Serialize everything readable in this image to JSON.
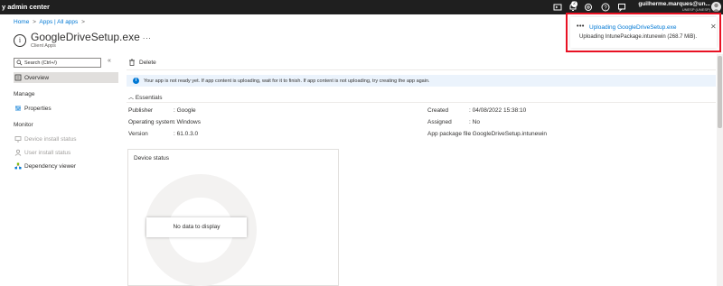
{
  "header": {
    "brand": "y admin center",
    "notification_count": "2",
    "user_name": "guilherme.marques@un...",
    "user_org": "UNESP (UNESP)"
  },
  "breadcrumb": {
    "items": [
      "Home",
      "Apps | All apps"
    ],
    "separator": ">"
  },
  "page": {
    "title": "GoogleDriveSetup.exe",
    "subtitle": "Client Apps",
    "more": "..."
  },
  "sidebar": {
    "search_placeholder": "Search (Ctrl+/)",
    "collapse": "«",
    "overview": "Overview",
    "manage_section": "Manage",
    "properties": "Properties",
    "monitor_section": "Monitor",
    "device_install_status": "Device install status",
    "user_install_status": "User install status",
    "dependency_viewer": "Dependency viewer"
  },
  "toolbar": {
    "delete_label": "Delete"
  },
  "info": {
    "message": "Your app is not ready yet. If app content is uploading, wait for it to finish. If app content is not uploading, try creating the app again."
  },
  "essentials": {
    "header": "Essentials",
    "left": [
      {
        "label": "Publisher",
        "value": "Google"
      },
      {
        "label": "Operating system",
        "value": "Windows"
      },
      {
        "label": "Version",
        "value": "61.0.3.0"
      }
    ],
    "right": [
      {
        "label": "Created",
        "value": "04/08/2022 15:38:10"
      },
      {
        "label": "Assigned",
        "value": "No"
      },
      {
        "label": "App package file",
        "value": "GoogleDriveSetup.intunewin"
      }
    ]
  },
  "device_status": {
    "title": "Device status",
    "empty": "No data to display"
  },
  "notification": {
    "title": "Uploading GoogleDriveSetup.exe",
    "message": "Uploading IntunePackage.intunewin (268.7 MiB).",
    "dots": "•••",
    "close": "✕"
  },
  "colors": {
    "accent": "#0078d4",
    "highlight_border": "#e81123",
    "topbar": "#1f1f1f",
    "info_background": "#ebf3fc"
  }
}
